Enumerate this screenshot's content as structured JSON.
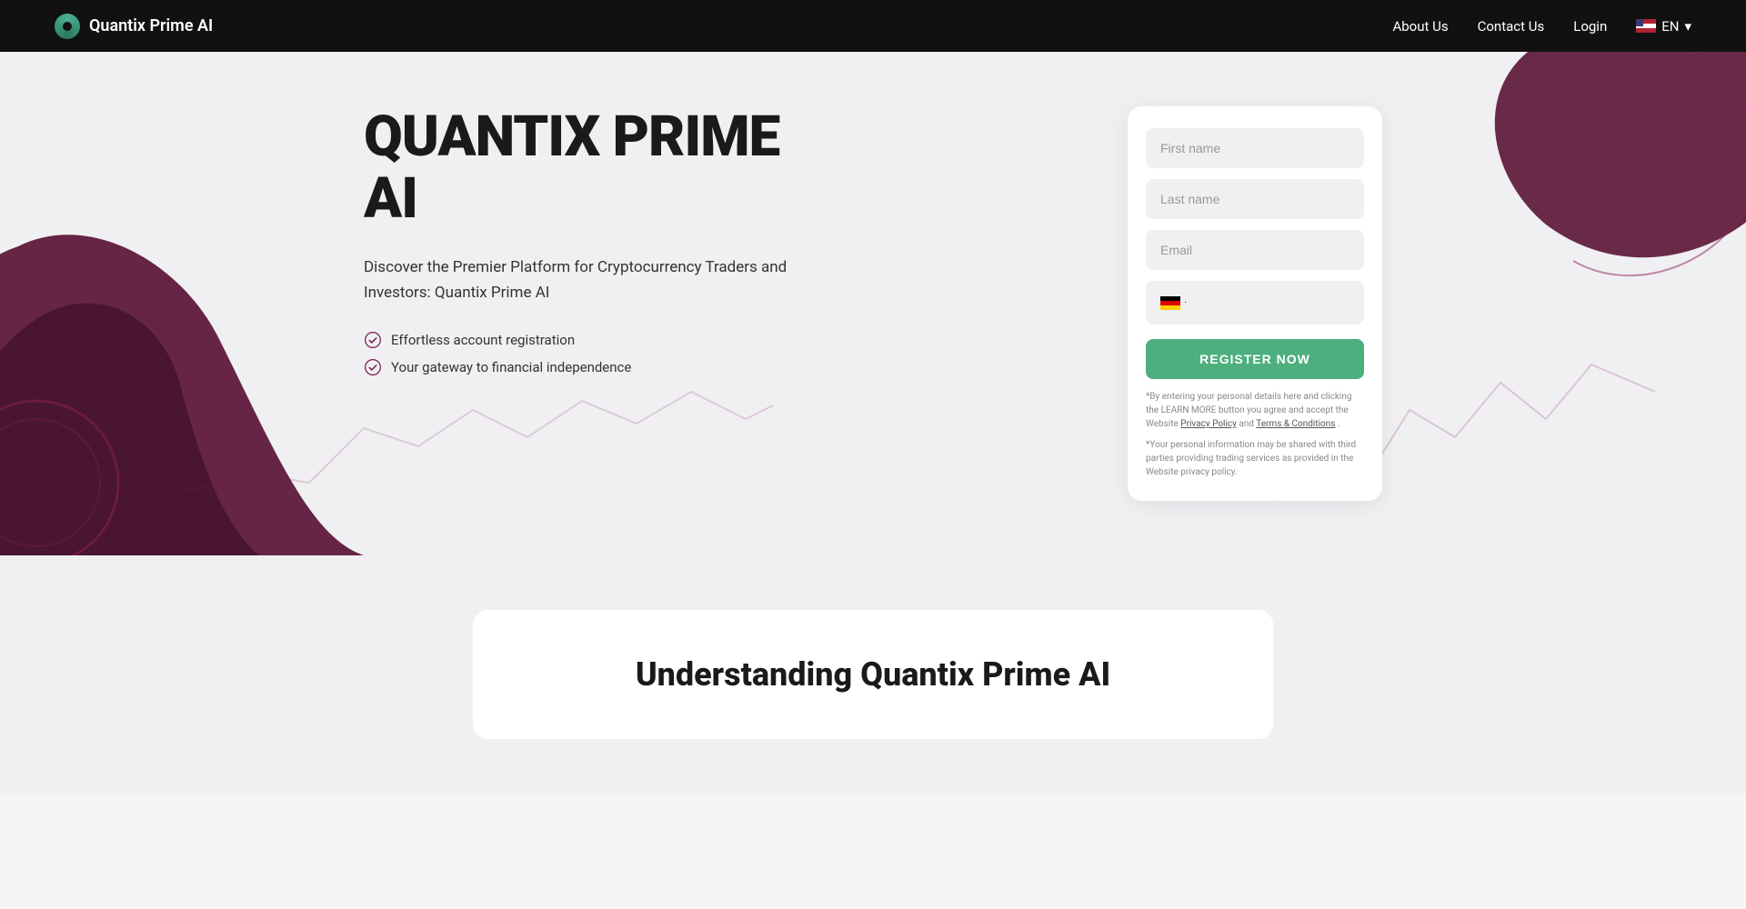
{
  "navbar": {
    "brand_name": "Quantix Prime AI",
    "links": [
      {
        "label": "About Us",
        "href": "#"
      },
      {
        "label": "Contact Us",
        "href": "#"
      },
      {
        "label": "Login",
        "href": "#"
      }
    ],
    "lang": "EN"
  },
  "hero": {
    "title_line1": "QUANTIX PRIME",
    "title_line2": "AI",
    "subtitle": "Discover the Premier Platform for Cryptocurrency Traders and Investors: Quantix Prime AI",
    "features": [
      "Effortless account registration",
      "Your gateway to financial independence"
    ]
  },
  "form": {
    "first_name_placeholder": "First name",
    "last_name_placeholder": "Last name",
    "email_placeholder": "Email",
    "register_button": "REGISTER NOW",
    "disclaimer1": "*By entering your personal details here and clicking the LEARN MORE button you agree and accept the Website",
    "privacy_policy": "Privacy Policy",
    "and": "and",
    "terms": "Terms & Conditions",
    "disclaimer1_end": ".",
    "disclaimer2": "*Your personal information may be shared with third parties providing trading services as provided in the Website privacy policy."
  },
  "understanding": {
    "title": "Understanding Quantix Prime AI"
  }
}
